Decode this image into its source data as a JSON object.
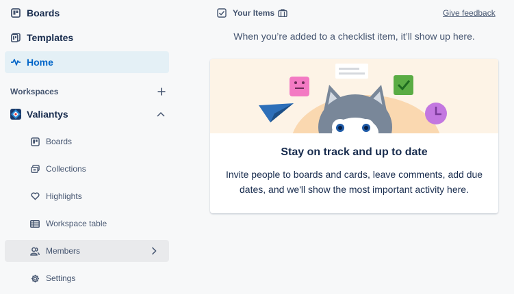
{
  "sidebar": {
    "top_items": [
      {
        "label": "Boards",
        "icon": "board-icon"
      },
      {
        "label": "Templates",
        "icon": "template-icon"
      },
      {
        "label": "Home",
        "icon": "activity-pulse-icon"
      }
    ],
    "workspaces_header": "Workspaces",
    "workspace": {
      "name": "Valiantys",
      "items": [
        {
          "label": "Boards",
          "icon": "board-icon"
        },
        {
          "label": "Collections",
          "icon": "collections-icon"
        },
        {
          "label": "Highlights",
          "icon": "heart-icon"
        },
        {
          "label": "Workspace table",
          "icon": "table-icon"
        },
        {
          "label": "Members",
          "icon": "members-icon"
        },
        {
          "label": "Settings",
          "icon": "gear-icon"
        }
      ]
    }
  },
  "main": {
    "header_title": "Your Items",
    "feedback_link": "Give feedback",
    "empty_message": "When you’re added to a checklist item, it’ll show up here.",
    "card": {
      "title": "Stay on track and up to date",
      "description": "Invite people to boards and cards, leave comments, add due dates, and we'll show the most important activity here."
    }
  },
  "colors": {
    "accent": "#0065c8",
    "active_bg": "#e4f0f6",
    "hover_bg": "#e9eaec",
    "illustration_bg": "#fdf3e6"
  }
}
